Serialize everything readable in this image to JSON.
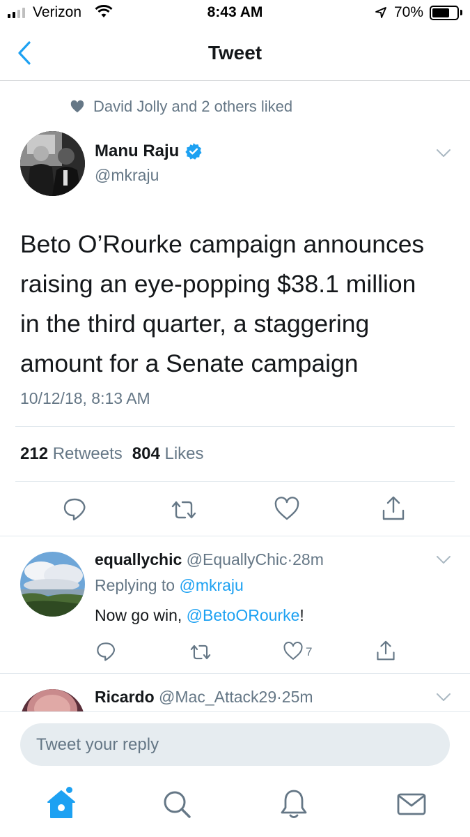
{
  "status_bar": {
    "carrier": "Verizon",
    "time": "8:43 AM",
    "battery": "70%",
    "battery_level": 0.7,
    "signal_bars_filled": 2,
    "signal_bars_total": 4
  },
  "nav": {
    "title": "Tweet",
    "back_icon": "chevron-left-icon"
  },
  "tweet": {
    "social_context": "David Jolly and 2 others liked",
    "author_name": "Manu Raju",
    "author_handle": "@mkraju",
    "verified": true,
    "text_lines": [
      "Beto O’Rourke campaign announces",
      "raising an eye-popping $38.1 million",
      "in the third quarter, a staggering",
      "amount for a Senate campaign"
    ],
    "timestamp": "10/12/18, 8:13 AM",
    "retweet_count": "212",
    "retweet_label": "Retweets",
    "like_count": "804",
    "like_label": "Likes"
  },
  "replies": [
    {
      "name": "equallychic",
      "handle": "@EquallyChic",
      "sep": "·",
      "time": "28m",
      "replying_label": "Replying to",
      "replying_to": "@mkraju",
      "text_before": "Now go win, ",
      "mention": "@BetoORourke",
      "text_after": "!",
      "like_count": "7"
    },
    {
      "name": "Ricardo",
      "handle": "@Mac_Attack29",
      "sep": "·",
      "time": "25m"
    }
  ],
  "composer": {
    "placeholder": "Tweet your reply"
  },
  "tabs": [
    "home-icon",
    "search-icon",
    "notifications-icon",
    "messages-icon"
  ],
  "colors": {
    "accent": "#1da1f2",
    "text": "#14171a",
    "muted": "#657786",
    "divider": "#e1e8ed"
  }
}
